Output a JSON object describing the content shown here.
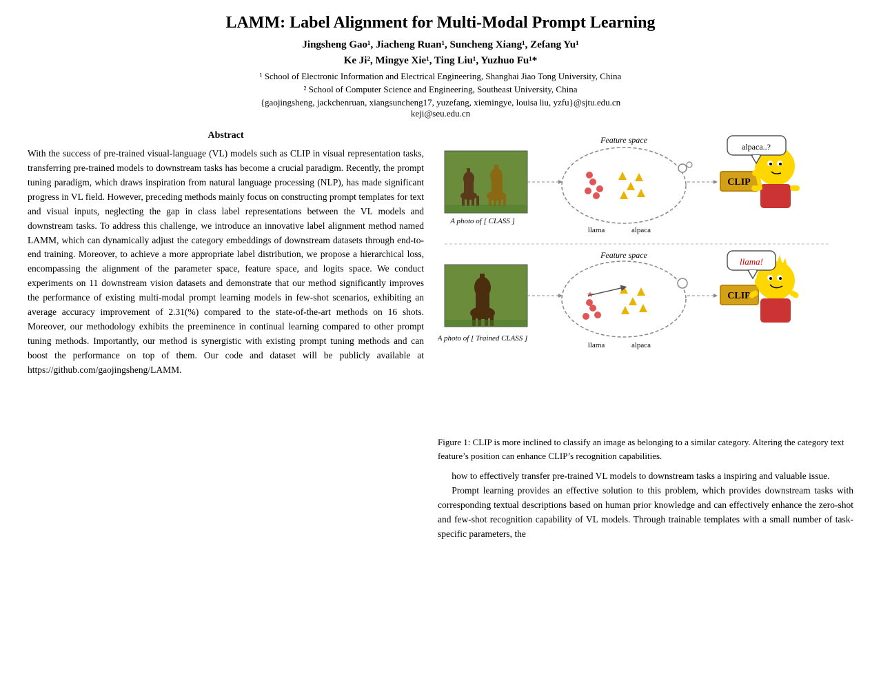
{
  "header": {
    "title": "LAMM: Label Alignment for Multi-Modal Prompt Learning",
    "authors_line1": "Jingsheng Gao¹, Jiacheng Ruan¹, Suncheng Xiang¹, Zefang Yu¹",
    "authors_line2": "Ke Ji², Mingye Xie¹, Ting Liu¹, Yuzhuo Fu¹*",
    "affiliation1": "¹ School of Electronic Information and Electrical Engineering, Shanghai Jiao Tong University, China",
    "affiliation2": "² School of Computer Science and Engineering, Southeast University, China",
    "emails_line1": "{gaojingsheng, jackchenruan, xiangsuncheng17, yuzefang, xiemingye, louisa liu, yzfu}@sjtu.edu.cn",
    "emails_line2": "keji@seu.edu.cn"
  },
  "abstract": {
    "title": "Abstract",
    "text": "With the success of pre-trained visual-language (VL) models such as CLIP in visual representation tasks, transferring pre-trained models to downstream tasks has become a crucial paradigm. Recently, the prompt tuning paradigm, which draws inspiration from natural language processing (NLP), has made significant progress in VL field. However, preceding methods mainly focus on constructing prompt templates for text and visual inputs, neglecting the gap in class label representations between the VL models and downstream tasks. To address this challenge, we introduce an innovative label alignment method named LAMM, which can dynamically adjust the category embeddings of downstream datasets through end-to-end training. Moreover, to achieve a more appropriate label distribution, we propose a hierarchical loss, encompassing the alignment of the parameter space, feature space, and logits space. We conduct experiments on 11 downstream vision datasets and demonstrate that our method significantly improves the performance of existing multi-modal prompt learning models in few-shot scenarios, exhibiting an average accuracy improvement of 2.31(%) compared to the state-of-the-art methods on 16 shots. Moreover, our methodology exhibits the preeminence in continual learning compared to other prompt tuning methods. Importantly, our method is synergistic with existing prompt tuning methods and can boost the performance on top of them. Our code and dataset will be publicly available at https://github.com/gaojingsheng/LAMM."
  },
  "figure1": {
    "label": "Figure 1:",
    "caption": " CLIP is more inclined to classify an image as belonging to a similar category. Altering the category text feature’s position can enhance CLIP’s recognition capabilities."
  },
  "body": {
    "paragraph1": "how to effectively transfer pre-trained VL models to downstream tasks a inspiring and valuable issue.",
    "paragraph2": "Prompt learning provides an effective solution to this problem, which provides downstream tasks with corresponding textual descriptions based on human prior knowledge and can effectively enhance the zero-shot and few-shot recognition capability of VL models. Through trainable templates with a small number of task-specific parameters, the"
  },
  "clip_icon": {
    "label": "CLIP",
    "color": "#D4A017"
  }
}
